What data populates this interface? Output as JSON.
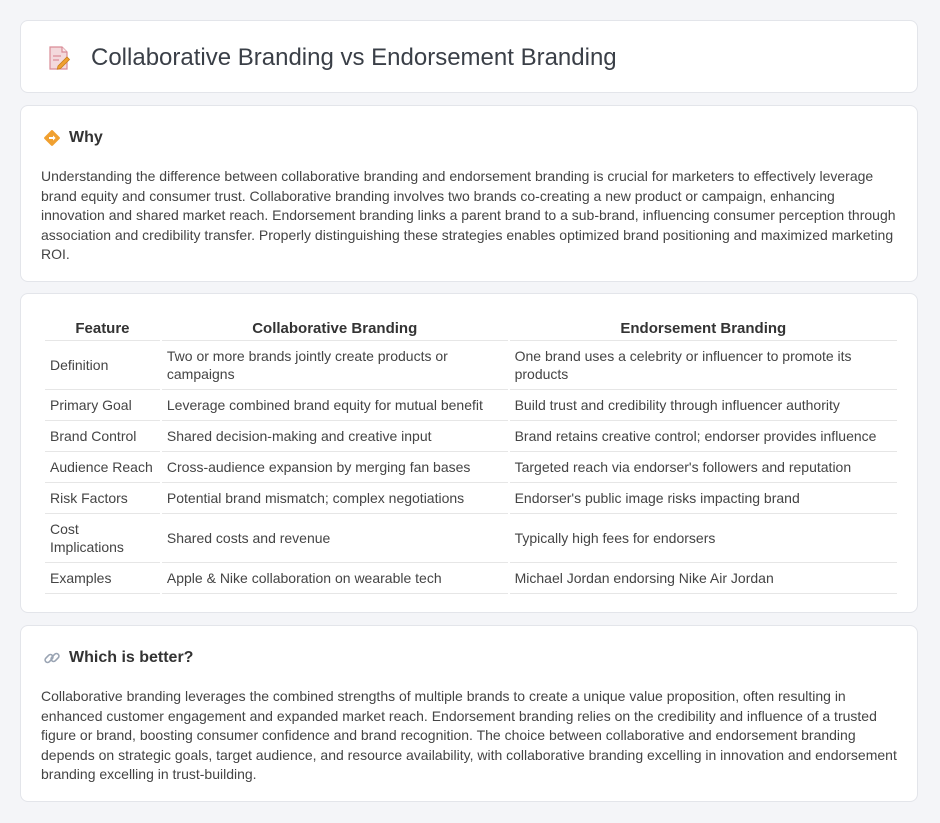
{
  "header": {
    "title": "Collaborative Branding vs Endorsement Branding",
    "icon": "document-edit-icon"
  },
  "why": {
    "title": "Why",
    "icon": "diamond-arrow-icon",
    "text": "Understanding the difference between collaborative branding and endorsement branding is crucial for marketers to effectively leverage brand equity and consumer trust. Collaborative branding involves two brands co-creating a new product or campaign, enhancing innovation and shared market reach. Endorsement branding links a parent brand to a sub-brand, influencing consumer perception through association and credibility transfer. Properly distinguishing these strategies enables optimized brand positioning and maximized marketing ROI."
  },
  "table": {
    "headers": [
      "Feature",
      "Collaborative Branding",
      "Endorsement Branding"
    ],
    "rows": [
      [
        "Definition",
        "Two or more brands jointly create products or campaigns",
        "One brand uses a celebrity or influencer to promote its products"
      ],
      [
        "Primary Goal",
        "Leverage combined brand equity for mutual benefit",
        "Build trust and credibility through influencer authority"
      ],
      [
        "Brand Control",
        "Shared decision-making and creative input",
        "Brand retains creative control; endorser provides influence"
      ],
      [
        "Audience Reach",
        "Cross-audience expansion by merging fan bases",
        "Targeted reach via endorser's followers and reputation"
      ],
      [
        "Risk Factors",
        "Potential brand mismatch; complex negotiations",
        "Endorser's public image risks impacting brand"
      ],
      [
        "Cost Implications",
        "Shared costs and revenue",
        "Typically high fees for endorsers"
      ],
      [
        "Examples",
        "Apple & Nike collaboration on wearable tech",
        "Michael Jordan endorsing Nike Air Jordan"
      ]
    ]
  },
  "better": {
    "title": "Which is better?",
    "icon": "link-icon",
    "text": "Collaborative branding leverages the combined strengths of multiple brands to create a unique value proposition, often resulting in enhanced customer engagement and expanded market reach. Endorsement branding relies on the credibility and influence of a trusted figure or brand, boosting consumer confidence and brand recognition. The choice between collaborative and endorsement branding depends on strategic goals, target audience, and resource availability, with collaborative branding excelling in innovation and endorsement branding excelling in trust-building."
  },
  "colors": {
    "background": "#f4f5f8",
    "card": "#ffffff",
    "accent_orange": "#f0a030",
    "icon_pink": "#e9a0a8"
  }
}
